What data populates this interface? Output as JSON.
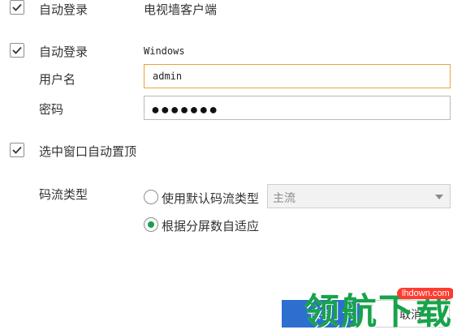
{
  "section_top": {
    "checkbox_label": "自动登录",
    "client_label": "电视墙客户端",
    "checked": true
  },
  "section_windows": {
    "checkbox_label": "自动登录",
    "platform_label": "Windows",
    "checked": true,
    "username": {
      "label": "用户名",
      "value": "admin"
    },
    "password": {
      "label": "密码",
      "masked": "●●●●●●●"
    }
  },
  "auto_top": {
    "label": "选中窗口自动置顶",
    "checked": true
  },
  "stream_type": {
    "label": "码流类型",
    "options": [
      {
        "label": "使用默认码流类型",
        "selected": false
      },
      {
        "label": "根据分屏数自适应",
        "selected": true
      }
    ],
    "select_value": "主流"
  },
  "buttons": {
    "save": "保存",
    "cancel": "取消"
  },
  "watermark": {
    "brand": "领航下载",
    "url": "lhdown.com"
  },
  "colors": {
    "accent": "#2d6fcf",
    "focus_border": "#e8a33c",
    "radio_dot": "#19a04a"
  }
}
